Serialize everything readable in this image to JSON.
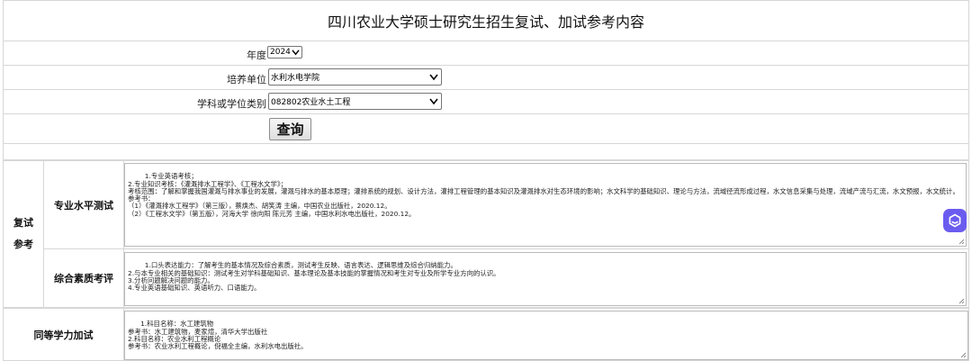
{
  "header": {
    "title": "四川农业大学硕士研究生招生复试、加试参考内容"
  },
  "filters": {
    "year_label": "年度",
    "year_value": "2024",
    "unit_label": "培养单位",
    "unit_value": "水利水电学院",
    "subject_label": "学科或学位类别",
    "subject_value": "082802农业水土工程",
    "query_button": "查询"
  },
  "retest": {
    "group_line1": "复试",
    "group_line2": "参考",
    "professional": {
      "label": "专业水平测试",
      "content": "1.专业英语考核；\n2.专业知识考核：《灌溉排水工程学》、《工程水文学》；\n考核范围：了解和掌握我国灌溉与排水事业的发展，灌溉与排水的基本原理；灌排系统的规划、设计方法，灌排工程管理的基本知识及灌溉排水对生态环境的影响；水文科学的基础知识、理论与方法，流域径流形成过程，水文信息采集与处理，流域产流与汇流，水文预报，水文统计。\n参考书：\n（1）《灌溉排水工程学》（第三版），蔡焕杰、胡笑涛 主编，中国农业出版社，2020.12。\n（2）《工程水文学》（第五版），河海大学 徐向阳 陈元芳 主编，中国水利水电出版社，2020.12。"
    },
    "comprehensive": {
      "label": "综合素质考评",
      "content": "1.口头表达能力：了解考生的基本情况及综合素质，测试考生反映、语言表达、逻辑思维及综合归纳能力。\n2.与本专业相关的基础知识：测试考生对学科基础知识、基本理论及基本技能的掌握情况和考生对专业及所学专业方向的认识。\n3.分析问题解决问题的能力。\n4.专业英语基础知识、英语听力、口语能力。"
    }
  },
  "extra": {
    "label": "同等学力加试",
    "content": "1.科目名称：水工建筑物\n参考书：水工建筑物，麦家煊，清华大学出版社\n2.科目名称：农业水利工程概论\n参考书：农业水利工程概论，倪福全主编，水利水电出版社。"
  },
  "colors": {
    "ai_badge": "#6b5cf0",
    "border": "#d7d7d7"
  }
}
